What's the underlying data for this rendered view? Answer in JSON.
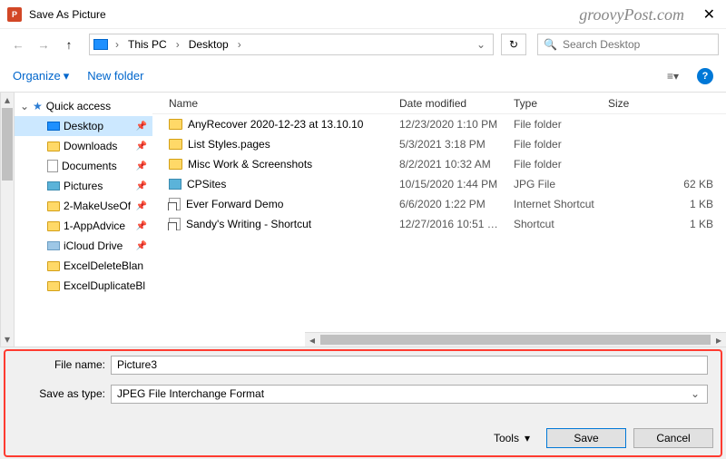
{
  "titlebar": {
    "title": "Save As Picture",
    "watermark": "groovyPost.com"
  },
  "address": {
    "root": "This PC",
    "folder": "Desktop",
    "search_placeholder": "Search Desktop"
  },
  "toolbar": {
    "organize": "Organize",
    "new_folder": "New folder"
  },
  "columns": {
    "name": "Name",
    "modified": "Date modified",
    "type": "Type",
    "size": "Size"
  },
  "tree": [
    {
      "label": "Quick access",
      "level": 1,
      "icon": "star",
      "expand": "v",
      "pin": false,
      "selected": false
    },
    {
      "label": "Desktop",
      "level": 2,
      "icon": "monitor",
      "expand": "",
      "pin": true,
      "selected": true
    },
    {
      "label": "Downloads",
      "level": 2,
      "icon": "folder",
      "expand": "",
      "pin": true,
      "selected": false
    },
    {
      "label": "Documents",
      "level": 2,
      "icon": "doc",
      "expand": "",
      "pin": true,
      "selected": false
    },
    {
      "label": "Pictures",
      "level": 2,
      "icon": "pic",
      "expand": "",
      "pin": true,
      "selected": false
    },
    {
      "label": "2-MakeUseOf",
      "level": 2,
      "icon": "folder",
      "expand": "",
      "pin": true,
      "selected": false
    },
    {
      "label": "1-AppAdvice",
      "level": 2,
      "icon": "folder",
      "expand": "",
      "pin": true,
      "selected": false
    },
    {
      "label": "iCloud Drive",
      "level": 2,
      "icon": "disk",
      "expand": "",
      "pin": true,
      "selected": false
    },
    {
      "label": "ExcelDeleteBlan",
      "level": 2,
      "icon": "folder",
      "expand": "",
      "pin": false,
      "selected": false
    },
    {
      "label": "ExcelDuplicateBl",
      "level": 2,
      "icon": "folder",
      "expand": "",
      "pin": false,
      "selected": false
    }
  ],
  "files": [
    {
      "name": "AnyRecover 2020-12-23 at 13.10.10",
      "modified": "12/23/2020 1:10 PM",
      "type": "File folder",
      "size": "",
      "icon": "folder"
    },
    {
      "name": "List Styles.pages",
      "modified": "5/3/2021 3:18 PM",
      "type": "File folder",
      "size": "",
      "icon": "folder"
    },
    {
      "name": "Misc Work & Screenshots",
      "modified": "8/2/2021 10:32 AM",
      "type": "File folder",
      "size": "",
      "icon": "folder"
    },
    {
      "name": "CPSites",
      "modified": "10/15/2020 1:44 PM",
      "type": "JPG File",
      "size": "62 KB",
      "icon": "img"
    },
    {
      "name": "Ever Forward Demo",
      "modified": "6/6/2020 1:22 PM",
      "type": "Internet Shortcut",
      "size": "1 KB",
      "icon": "shortcut"
    },
    {
      "name": "Sandy's Writing - Shortcut",
      "modified": "12/27/2016 10:51 …",
      "type": "Shortcut",
      "size": "1 KB",
      "icon": "shortcut"
    }
  ],
  "form": {
    "file_name_label": "File name:",
    "file_name_value": "Picture3",
    "save_type_label": "Save as type:",
    "save_type_value": "JPEG File Interchange Format",
    "tools_label": "Tools",
    "save_label": "Save",
    "cancel_label": "Cancel"
  }
}
